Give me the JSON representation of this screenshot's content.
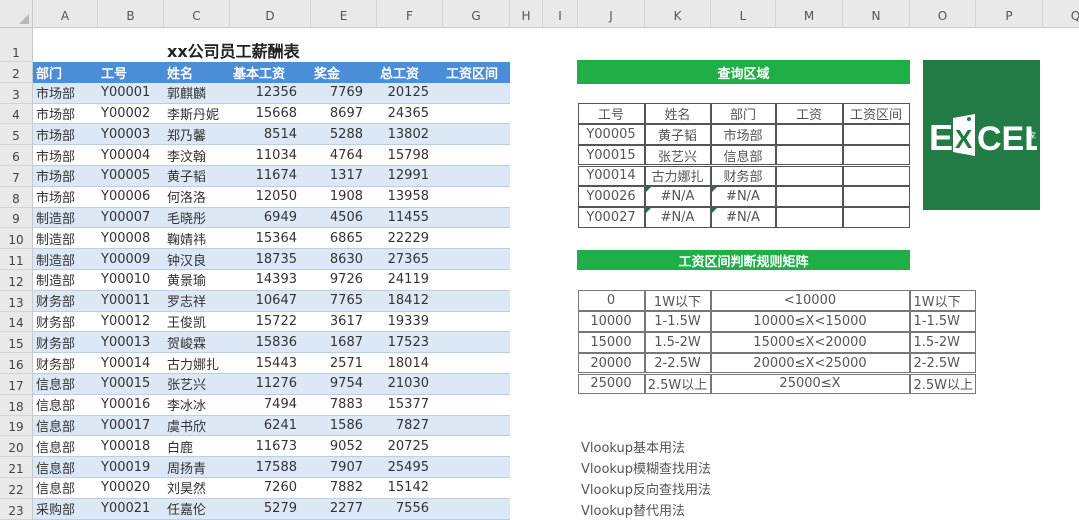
{
  "columns": [
    "A",
    "B",
    "C",
    "D",
    "E",
    "F",
    "G",
    "H",
    "I",
    "J",
    "K",
    "L",
    "M",
    "N",
    "O",
    "P",
    "Q"
  ],
  "rows": [
    "1",
    "2",
    "3",
    "4",
    "5",
    "6",
    "7",
    "8",
    "9",
    "10",
    "11",
    "12",
    "13",
    "14",
    "15",
    "16",
    "17",
    "18",
    "19",
    "20",
    "21",
    "22",
    "23"
  ],
  "salary_table": {
    "title": "xx公司员工薪酬表",
    "headers": [
      "部门",
      "工号",
      "姓名",
      "基本工资",
      "奖金",
      "总工资",
      "工资区间"
    ],
    "rows": [
      [
        "市场部",
        "Y00001",
        "郭麒麟",
        "12356",
        "7769",
        "20125"
      ],
      [
        "市场部",
        "Y00002",
        "李斯丹妮",
        "15668",
        "8697",
        "24365"
      ],
      [
        "市场部",
        "Y00003",
        "郑乃馨",
        "8514",
        "5288",
        "13802"
      ],
      [
        "市场部",
        "Y00004",
        "李汶翰",
        "11034",
        "4764",
        "15798"
      ],
      [
        "市场部",
        "Y00005",
        "黄子韬",
        "11674",
        "1317",
        "12991"
      ],
      [
        "市场部",
        "Y00006",
        "何洛洛",
        "12050",
        "1908",
        "13958"
      ],
      [
        "制造部",
        "Y00007",
        "毛晓彤",
        "6949",
        "4506",
        "11455"
      ],
      [
        "制造部",
        "Y00008",
        "鞠婧祎",
        "15364",
        "6865",
        "22229"
      ],
      [
        "制造部",
        "Y00009",
        "钟汉良",
        "18735",
        "8630",
        "27365"
      ],
      [
        "制造部",
        "Y00010",
        "黄景瑜",
        "14393",
        "9726",
        "24119"
      ],
      [
        "财务部",
        "Y00011",
        "罗志祥",
        "10647",
        "7765",
        "18412"
      ],
      [
        "财务部",
        "Y00012",
        "王俊凯",
        "15722",
        "3617",
        "19339"
      ],
      [
        "财务部",
        "Y00013",
        "贺峻霖",
        "15836",
        "1687",
        "17523"
      ],
      [
        "财务部",
        "Y00014",
        "古力娜扎",
        "15443",
        "2571",
        "18014"
      ],
      [
        "信息部",
        "Y00015",
        "张艺兴",
        "11276",
        "9754",
        "21030"
      ],
      [
        "信息部",
        "Y00016",
        "李冰冰",
        "7494",
        "7883",
        "15377"
      ],
      [
        "信息部",
        "Y00017",
        "虞书欣",
        "6241",
        "1586",
        "7827"
      ],
      [
        "信息部",
        "Y00018",
        "白鹿",
        "11673",
        "9052",
        "20725"
      ],
      [
        "信息部",
        "Y00019",
        "周扬青",
        "17588",
        "7907",
        "25495"
      ],
      [
        "信息部",
        "Y00020",
        "刘昊然",
        "7260",
        "7882",
        "15142"
      ],
      [
        "采购部",
        "Y00021",
        "任嘉伦",
        "5279",
        "2277",
        "7556"
      ]
    ]
  },
  "query": {
    "banner": "查询区域",
    "headers": [
      "工号",
      "姓名",
      "部门",
      "工资",
      "工资区间"
    ],
    "rows": [
      [
        "Y00005",
        "黄子韬",
        "市场部",
        "",
        ""
      ],
      [
        "Y00015",
        "张艺兴",
        "信息部",
        "",
        ""
      ],
      [
        "Y00014",
        "古力娜扎",
        "财务部",
        "",
        ""
      ],
      [
        "Y00026",
        "#N/A",
        "#N/A",
        "",
        ""
      ],
      [
        "Y00027",
        "#N/A",
        "#N/A",
        "",
        ""
      ]
    ]
  },
  "matrix": {
    "banner": "工资区间判断规则矩阵",
    "rows": [
      [
        "0",
        "1W以下",
        "<10000",
        "1W以下"
      ],
      [
        "10000",
        "1-1.5W",
        "10000≤X<15000",
        "1-1.5W"
      ],
      [
        "15000",
        "1.5-2W",
        "15000≤X<20000",
        "1.5-2W"
      ],
      [
        "20000",
        "2-2.5W",
        "20000≤X<25000",
        "2-2.5W"
      ],
      [
        "25000",
        "2.5W以上",
        "25000≤X",
        "2.5W以上"
      ]
    ]
  },
  "logo": {
    "text_e": "E",
    "text_x": "X",
    "text_cel": "CEL",
    "text_jia": "家"
  },
  "links": [
    "Vlookup基本用法",
    "Vlookup模糊查找用法",
    "Vlookup反向查找用法",
    "Vlookup替代用法"
  ],
  "colors": {
    "header_blue": "#4b8dd6",
    "band": "#dce8f5",
    "banner_green": "#1fae48",
    "logo_green": "#227a45"
  }
}
